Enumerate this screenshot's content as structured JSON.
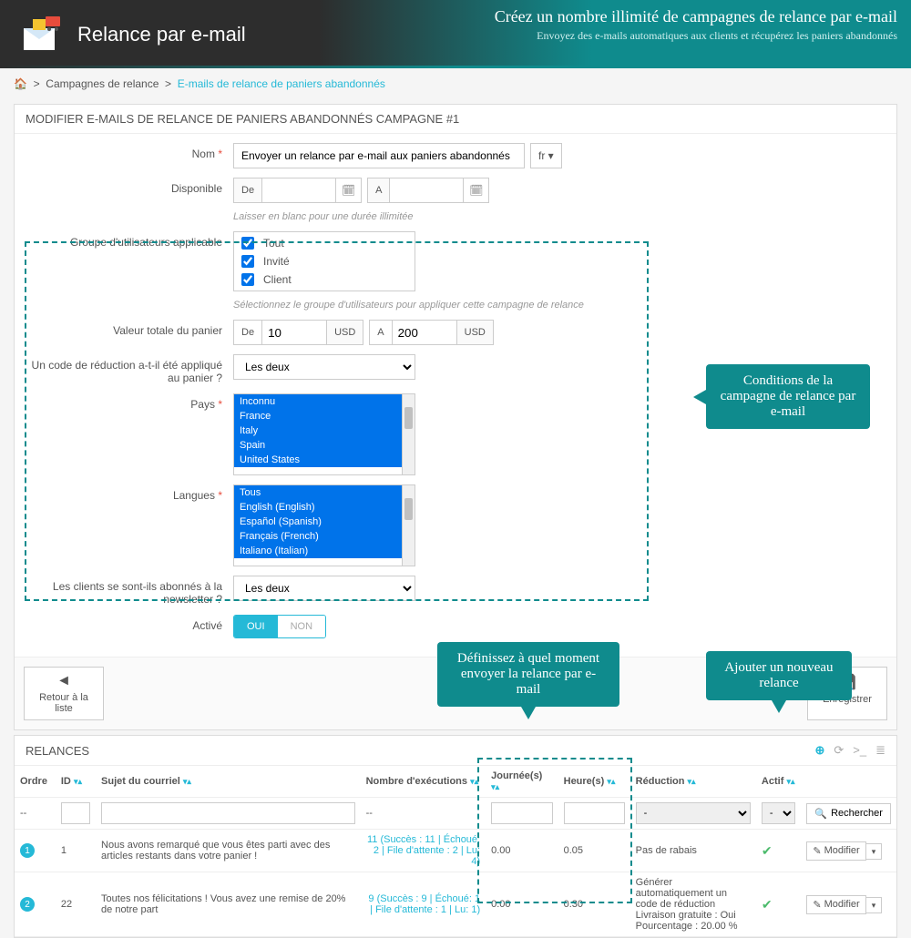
{
  "header": {
    "title": "Relance par e-mail",
    "right_title": "Créez un nombre illimité de campagnes de relance par e-mail",
    "right_sub": "Envoyez des e-mails automatiques aux clients et récupérez les paniers abandonnés"
  },
  "breadcrumb": {
    "level1": "Campagnes de relance",
    "current": "E-mails de relance de paniers abandonnés"
  },
  "form": {
    "heading": "MODIFIER E-MAILS DE RELANCE DE PANIERS ABANDONNÉS CAMPAGNE #1",
    "name_label": "Nom",
    "name_value": "Envoyer un relance par e-mail aux paniers abandonnés",
    "lang": "fr",
    "available_label": "Disponible",
    "from": "De",
    "to": "A",
    "available_help": "Laisser en blanc pour une durée illimitée",
    "group_label": "Groupe d'utilisateurs applicable",
    "group_all": "Tout",
    "group_guest": "Invité",
    "group_client": "Client",
    "group_help": "Sélectionnez le groupe d'utilisateurs pour appliquer cette campagne de relance",
    "cart_value_label": "Valeur totale du panier",
    "cart_from": "10",
    "cart_to": "200",
    "currency": "USD",
    "discount_applied_label": "Un code de réduction a-t-il été appliqué au panier ?",
    "both": "Les deux",
    "country_label": "Pays",
    "countries": [
      "Inconnu",
      "France",
      "Italy",
      "Spain",
      "United States"
    ],
    "lang_label": "Langues",
    "languages": [
      "Tous",
      "English (English)",
      "Español (Spanish)",
      "Français (French)",
      "Italiano (Italian)"
    ],
    "newsletter_label": "Les clients se sont-ils abonnés à la newsletter ?",
    "enabled_label": "Activé",
    "yes": "OUI",
    "no": "NON",
    "back": "Retour à la liste",
    "save": "Enregistrer"
  },
  "callouts": {
    "c1": "Conditions de la campagne de relance par e-mail",
    "c2": "Définissez à quel moment envoyer la relance par e-mail",
    "c3": "Ajouter un nouveau relance"
  },
  "table": {
    "heading": "RELANCES",
    "cols": {
      "order": "Ordre",
      "id": "ID",
      "subject": "Sujet du courriel",
      "runs": "Nombre d'exécutions",
      "days": "Journée(s)",
      "hours": "Heure(s)",
      "discount": "Réduction",
      "active": "Actif"
    },
    "search": "Rechercher",
    "edit": "Modifier",
    "rows": [
      {
        "order": "1",
        "id": "1",
        "subject": "Nous avons remarqué que vous êtes parti avec des articles restants dans votre panier !",
        "runs": "11 (Succès : 11 | Échoué: 2 | File d'attente : 2 | Lu: 4)",
        "days": "0.00",
        "hours": "0.05",
        "discount": "Pas de rabais"
      },
      {
        "order": "2",
        "id": "22",
        "subject": "Toutes nos félicitations ! Vous avez une remise de 20% de notre part",
        "runs": "9 (Succès : 9 | Échoué: 1 | File d'attente : 1 | Lu: 1)",
        "days": "0.00",
        "hours": "0.30",
        "discount": "Générer automatiquement un code de réduction\nLivraison gratuite : Oui\nPourcentage : 20.00 %"
      }
    ]
  }
}
